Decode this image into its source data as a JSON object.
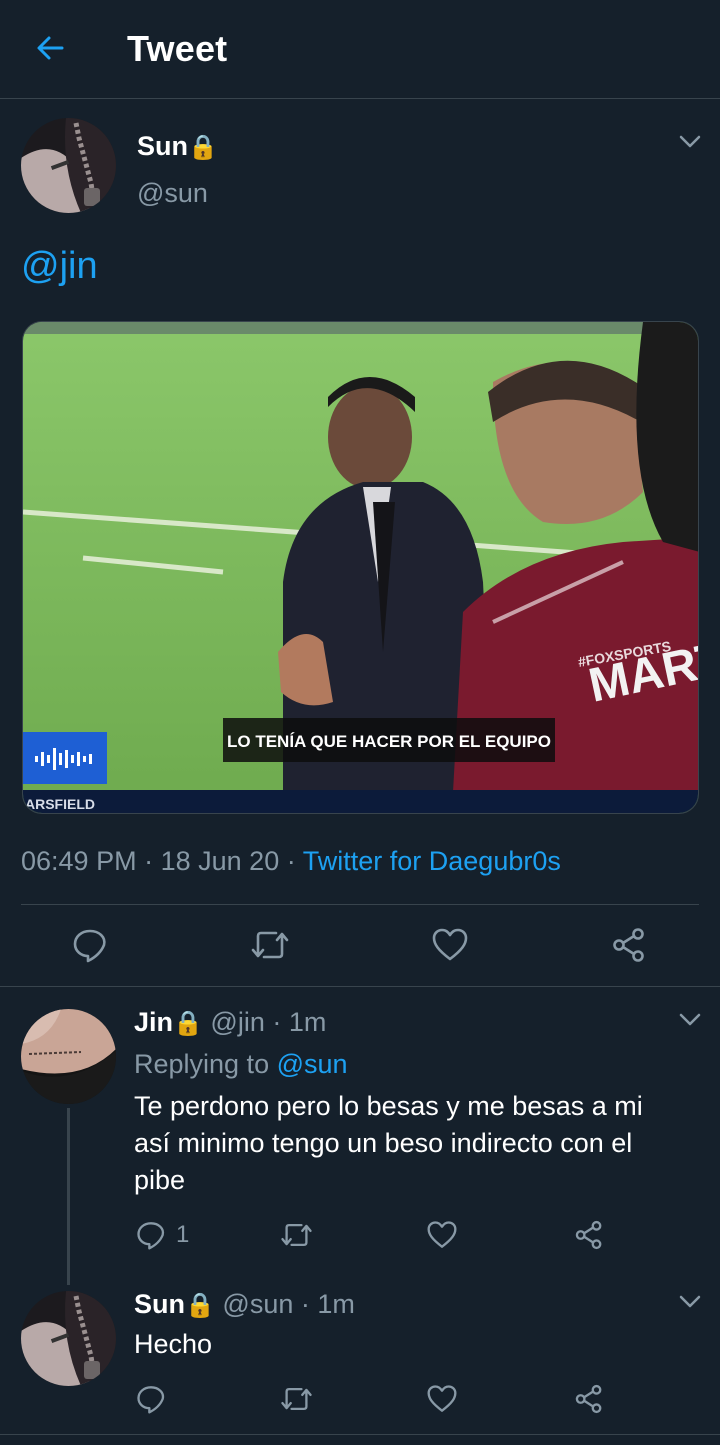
{
  "header": {
    "title": "Tweet",
    "back_icon": "arrow-left-icon",
    "accent": "#1da1f2"
  },
  "main_tweet": {
    "author_name": "Sun",
    "author_lock": "🔒",
    "author_handle": "@sun",
    "text": "@jin",
    "media": {
      "caption": "LO TENÍA QUE HACER POR EL EQUIPO",
      "corner_text": "ARSFIELD",
      "jersey_text": "MARTI",
      "watermark": "#FOXSPORTS"
    },
    "time": "06:49 PM",
    "sep1": "·",
    "date": "18 Jun 20",
    "sep2": "·",
    "source": "Twitter for Daegubr0s",
    "actions": [
      "reply-icon",
      "retweet-icon",
      "like-icon",
      "share-icon"
    ]
  },
  "replies": [
    {
      "author_name": "Jin",
      "author_lock": "🔒",
      "author_handle": "@jin",
      "sep": "·",
      "time": "1m",
      "replying_prefix": "Replying to",
      "replying_handle": "@sun",
      "text_lines": [
        "Te perdono pero lo besas y me besas a mi",
        "así minimo tengo un beso indirecto con el",
        "pibe"
      ],
      "reply_count": "1"
    },
    {
      "author_name": "Sun",
      "author_lock": "🔒",
      "author_handle": "@sun",
      "sep": "·",
      "time": "1m",
      "text_lines": [
        "Hecho"
      ],
      "reply_count": ""
    }
  ],
  "colors": {
    "background": "#15202b",
    "border": "#38444d",
    "muted": "#8899a6",
    "link": "#1da1f2"
  }
}
